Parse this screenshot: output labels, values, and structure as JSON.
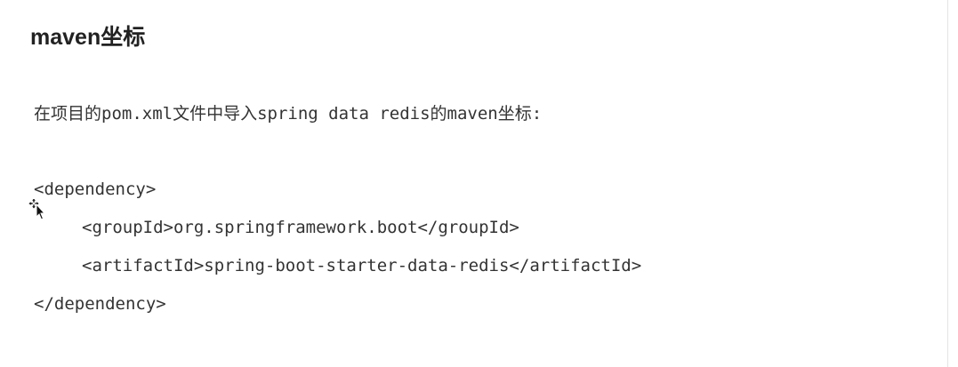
{
  "section": {
    "title": "maven坐标",
    "intro": "在项目的pom.xml文件中导入spring data redis的maven坐标:"
  },
  "code": {
    "lines": [
      "<dependency>",
      "<groupId>org.springframework.boot</groupId>",
      "<artifactId>spring-boot-starter-data-redis</artifactId>",
      "</dependency>"
    ]
  },
  "icons": {
    "cursor": "move-cursor-icon"
  }
}
